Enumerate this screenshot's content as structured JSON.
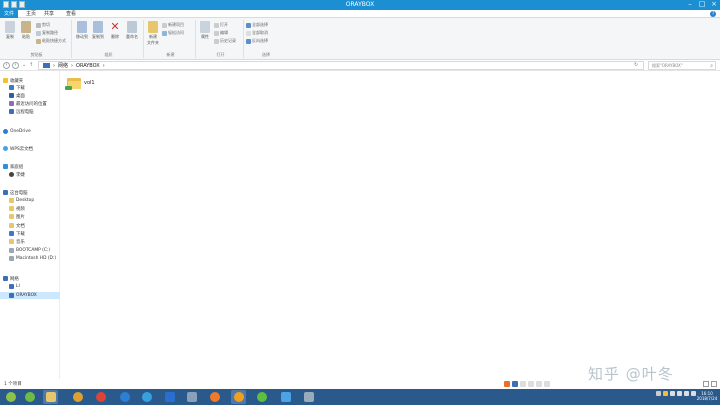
{
  "window": {
    "title": "ORAYBOX"
  },
  "menu": {
    "file": "文件",
    "home": "主页",
    "share": "共享",
    "view": "查看"
  },
  "ribbon": {
    "groups": {
      "clipboard": "剪贴板",
      "organize": "组织",
      "new": "新建",
      "open": "打开",
      "select": "选择"
    },
    "copy": "复制",
    "paste": "粘贴",
    "cut": "剪切",
    "copy_path": "复制路径",
    "paste_shortcut": "粘贴快捷方式",
    "move_to": "移动到",
    "copy_to": "复制到",
    "delete": "删除",
    "rename": "重命名",
    "new_folder": "新建\n文件夹",
    "new_item": "新建项目",
    "easy_access": "轻松访问",
    "properties": "属性",
    "open_btn": "打开",
    "edit": "编辑",
    "history": "历史记录",
    "select_all": "全部选择",
    "select_none": "全部取消",
    "invert": "反向选择"
  },
  "address": {
    "segments": [
      "网络",
      "ORAYBOX"
    ],
    "search_placeholder": "搜索\"ORAYBOX\""
  },
  "navpane": {
    "favorites": "收藏夹",
    "downloads": "下载",
    "desktop": "桌面",
    "recent": "最近访问的位置",
    "remote": "远程电脑",
    "onedrive": "OneDrive",
    "wps": "WPS云文档",
    "homegroup": "家庭组",
    "homegroup_user": "李婕",
    "thispc": "这台电脑",
    "pc_desktop": "Desktop",
    "pc_videos": "视频",
    "pc_pictures": "图片",
    "pc_docs": "文档",
    "pc_downloads": "下载",
    "pc_music": "音乐",
    "bootcamp": "BOOTCAMP (C:)",
    "mac": "Macintosh HD (D:)",
    "network": "网络",
    "net_li": "LI",
    "net_oray": "ORAYBOX"
  },
  "content": {
    "items": [
      {
        "name": "vol1"
      }
    ]
  },
  "status": {
    "count": "1 个项目"
  },
  "watermark": "知乎 @叶冬",
  "clock": {
    "time": "16:10",
    "date": "2018/7/24"
  }
}
